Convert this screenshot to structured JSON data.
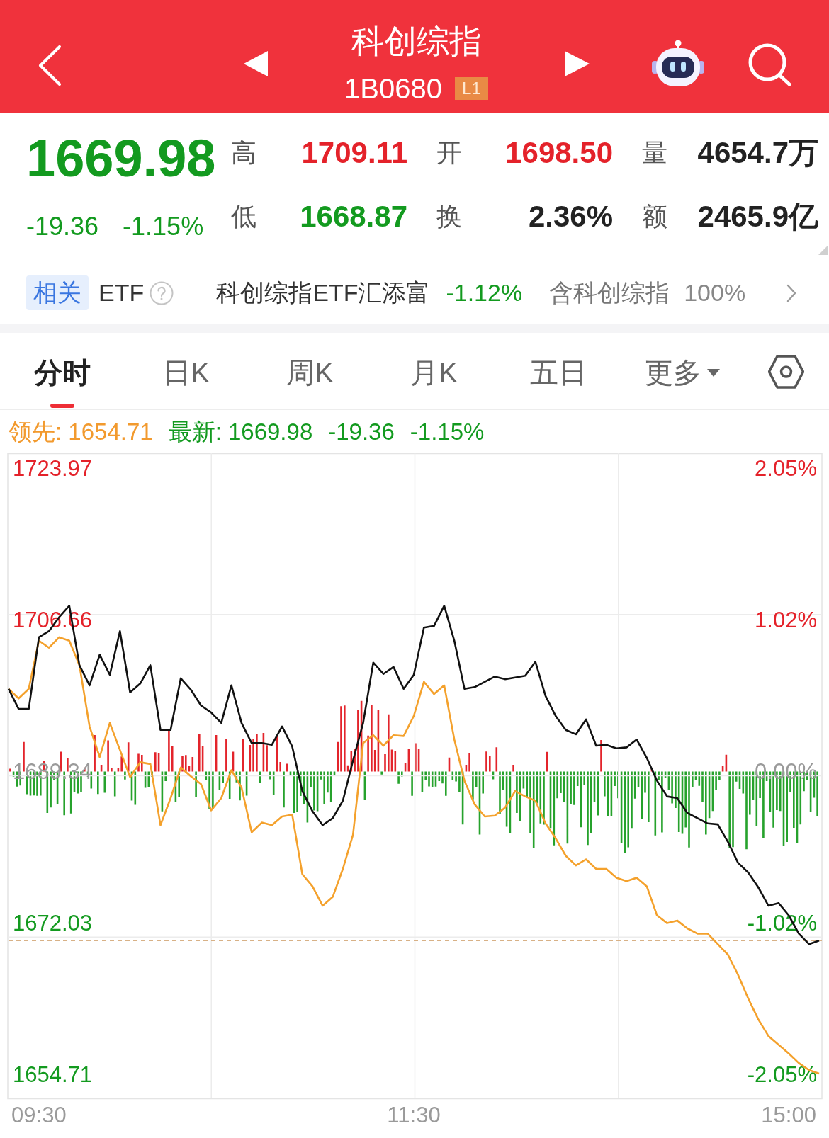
{
  "header": {
    "title": "科创综指",
    "code": "1B0680",
    "level_badge": "L1"
  },
  "quote": {
    "price": "1669.98",
    "change": "-19.36",
    "change_percent": "-1.15%",
    "color": "#139a1f"
  },
  "stats": [
    {
      "label": "高",
      "value": "1709.11",
      "color": "#e4222a"
    },
    {
      "label": "开",
      "value": "1698.50",
      "color": "#e4222a"
    },
    {
      "label": "量",
      "value": "4654.7万",
      "color": "#222222"
    },
    {
      "label": "低",
      "value": "1668.87",
      "color": "#139a1f"
    },
    {
      "label": "换",
      "value": "2.36%",
      "color": "#222222"
    },
    {
      "label": "额",
      "value": "2465.9亿",
      "color": "#222222"
    }
  ],
  "related_etf": {
    "tag": "相关",
    "label": "ETF",
    "fund_name": "科创综指ETF汇添富",
    "change": "-1.12%",
    "color": "#139a1f",
    "holding_label": "含科创综指",
    "holding_percent": "100%"
  },
  "tabs": [
    {
      "label": "分时",
      "selected": true,
      "kind": "tab"
    },
    {
      "label": "日K",
      "selected": false,
      "kind": "tab"
    },
    {
      "label": "周K",
      "selected": false,
      "kind": "tab"
    },
    {
      "label": "月K",
      "selected": false,
      "kind": "tab"
    },
    {
      "label": "五日",
      "selected": false,
      "kind": "tab"
    },
    {
      "label": "更多",
      "selected": false,
      "kind": "dropdown"
    }
  ],
  "chart": {
    "legend": [
      {
        "text": "领先: 1654.71",
        "color": "#f29a2e"
      },
      {
        "text": "最新: 1669.98",
        "color": "#139a1f"
      },
      {
        "text": "-19.36",
        "color": "#139a1f"
      },
      {
        "text": "-1.15%",
        "color": "#139a1f"
      }
    ],
    "right_axis_labels": [
      "2.05%",
      "1.02%",
      "0.00%",
      "-1.02%",
      "-2.05%"
    ],
    "chart_data": {
      "type": "line",
      "categories": [
        null,
        null,
        null,
        "09:30",
        null,
        null,
        null,
        null,
        null,
        null,
        null,
        null,
        null,
        null,
        null,
        null,
        null,
        null,
        null,
        null,
        null,
        null,
        null,
        null,
        null,
        null,
        null,
        null,
        null,
        null,
        null,
        null,
        null,
        null,
        null,
        null,
        null,
        null,
        null,
        null,
        "11:30",
        null,
        null,
        null,
        null,
        null,
        null,
        null,
        null,
        null,
        null,
        null,
        null,
        null,
        null,
        null,
        null,
        null,
        null,
        null,
        null,
        null,
        null,
        null,
        null,
        null,
        null,
        null,
        null,
        null,
        null,
        null,
        null,
        null,
        null,
        null,
        null,
        "15:00",
        null,
        null,
        null
      ],
      "ylim": [
        1651.96,
        1725.75
      ],
      "yticks": [
        {
          "value": 1723.97,
          "label": "1723.97"
        },
        {
          "value": 1706.66,
          "label": "1706.66"
        },
        {
          "value": 1689.34,
          "label": "1689.34"
        },
        {
          "value": 1672.03,
          "label": "1672.03"
        },
        {
          "value": 1654.71,
          "label": "1654.71"
        }
      ],
      "series": [
        {
          "color": "#f4a12c",
          "values": [
            1698.8,
            1697.7,
            1698.8,
            1704.3,
            1703.5,
            1704.7,
            1704.3,
            1701.5,
            1694.5,
            1691.0,
            1694.9,
            1691.8,
            1688.7,
            1690.4,
            1690.2,
            1683.2,
            1686.3,
            1689.8,
            1688.8,
            1687.9,
            1684.9,
            1686.3,
            1689.5,
            1687.5,
            1682.4,
            1683.5,
            1683.2,
            1684.2,
            1684.4,
            1677.6,
            1676.2,
            1674.0,
            1675.0,
            1678.2,
            1682.1,
            1692.6,
            1693.5,
            1692.3,
            1693.5,
            1693.4,
            1695.7,
            1699.6,
            1698.2,
            1699.2,
            1693.0,
            1688.3,
            1685.6,
            1684.2,
            1684.3,
            1685.2,
            1687.1,
            1686.5,
            1686.0,
            1683.4,
            1681.7,
            1679.7,
            1678.6,
            1679.3,
            1678.2,
            1678.2,
            1677.2,
            1676.8,
            1677.2,
            1676.2,
            1672.9,
            1672.0,
            1672.3,
            1671.4,
            1670.8,
            1670.8,
            1669.6,
            1668.4,
            1666.1,
            1663.4,
            1661.0,
            1659.1,
            1658.1,
            1657.1,
            1656.0,
            1655.2,
            1654.8
          ]
        },
        {
          "color": "#111111",
          "values": [
            1698.8,
            1696.5,
            1696.5,
            1704.7,
            1705.4,
            1707.0,
            1708.3,
            1701.5,
            1699.2,
            1702.7,
            1700.4,
            1705.4,
            1698.4,
            1699.4,
            1701.5,
            1694.1,
            1694.1,
            1700.0,
            1698.7,
            1696.9,
            1696.1,
            1694.9,
            1699.2,
            1694.9,
            1692.6,
            1692.6,
            1692.4,
            1694.5,
            1692.2,
            1687.1,
            1684.8,
            1683.2,
            1684.0,
            1686.0,
            1690.6,
            1694.9,
            1701.8,
            1700.5,
            1701.3,
            1698.8,
            1700.4,
            1705.8,
            1706.0,
            1708.3,
            1704.3,
            1698.8,
            1699.0,
            1699.6,
            1700.2,
            1699.9,
            1700.1,
            1700.3,
            1701.9,
            1698.0,
            1695.7,
            1694.1,
            1693.6,
            1695.3,
            1692.3,
            1692.4,
            1692.0,
            1692.1,
            1693.0,
            1690.9,
            1688.3,
            1686.5,
            1686.3,
            1684.6,
            1684.0,
            1683.4,
            1683.3,
            1681.3,
            1678.9,
            1677.8,
            1676.1,
            1674.0,
            1674.3,
            1672.9,
            1670.8,
            1669.6,
            1670.0
          ]
        }
      ],
      "ref_lines": [
        {
          "axis": "y",
          "value": 1670.0
        }
      ]
    }
  }
}
